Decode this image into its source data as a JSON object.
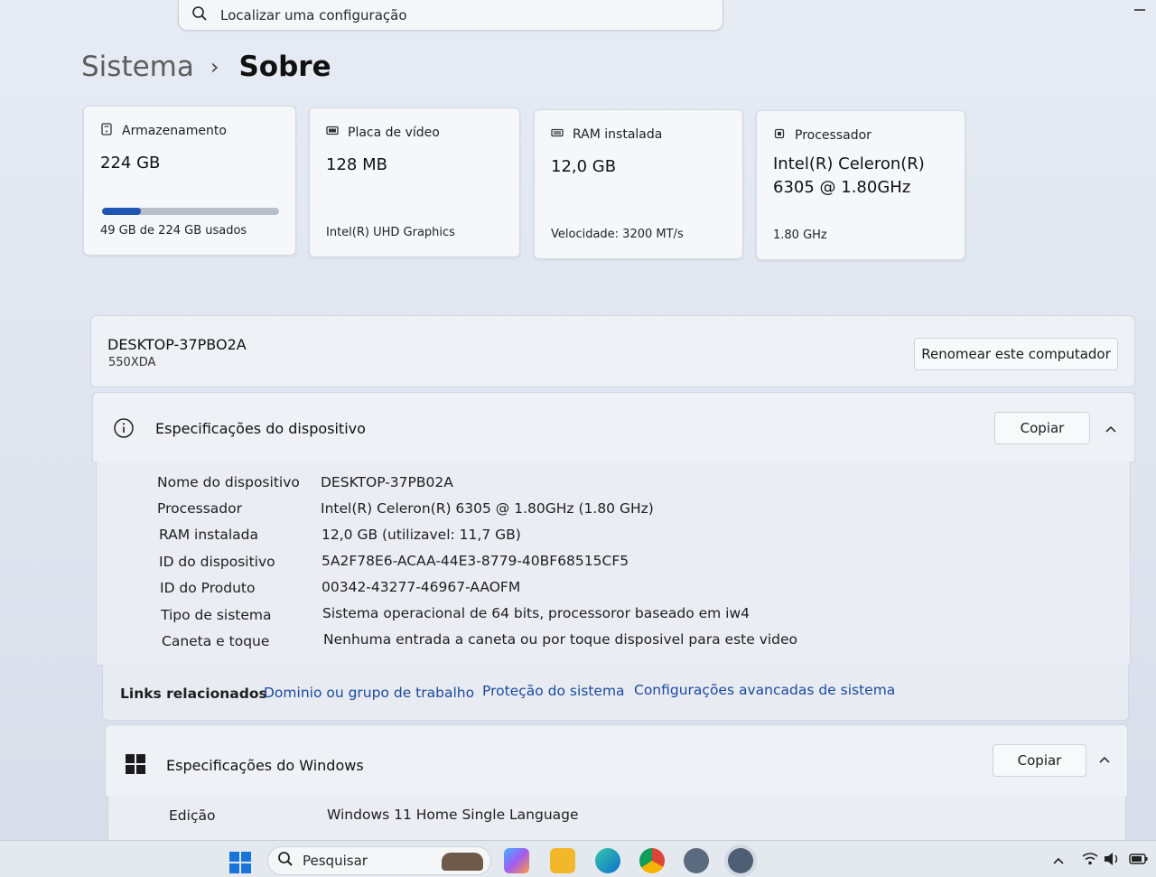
{
  "search": {
    "placeholder": "Localizar uma configuração"
  },
  "breadcrumb": {
    "parent": "Sistema",
    "separator": "›",
    "current": "Sobre"
  },
  "cards": [
    {
      "title": "Armazenamento",
      "value": "224 GB",
      "detail": "49 GB de 224 GB usados",
      "usage_fraction": 0.22
    },
    {
      "title": "Placa de vídeo",
      "value": "128 MB",
      "detail": "Intel(R) UHD Graphics"
    },
    {
      "title": "RAM instalada",
      "value": "12,0 GB",
      "detail": "Velocidade: 3200 MT/s"
    },
    {
      "title": "Processador",
      "value_line1": "Intel(R) Celeron(R)",
      "value_line2": "6305 @ 1.80GHz",
      "detail": "1.80 GHz"
    }
  ],
  "computer": {
    "name": "DESKTOP-37PBO2A",
    "model": "550XDA",
    "rename_label": "Renomear este computador"
  },
  "device_specs": {
    "title": "Especificações do dispositivo",
    "copy_label": "Copiar",
    "rows": [
      {
        "label": "Nome do dispositivo",
        "value": "DESKTOP-37PB02A"
      },
      {
        "label": "Processador",
        "value": "Intel(R) Celeron(R) 6305 @ 1.80GHz (1.80 GHz)"
      },
      {
        "label": "RAM instalada",
        "value": "12,0 GB (utilizavel: 11,7 GB)"
      },
      {
        "label": "ID do dispositivo",
        "value": "5A2F78E6-ACAA-44E3-8779-40BF68515CF5"
      },
      {
        "label": "ID do Produto",
        "value": "00342-43277-46967-AAOFM"
      },
      {
        "label": "Tipo de sistema",
        "value": "Sistema operacional de 64 bits, processoror baseado em iw4"
      },
      {
        "label": "Caneta e toque",
        "value": "Nenhuma entrada a caneta ou por toque disposivel para este video"
      }
    ]
  },
  "related_links": {
    "label": "Links relacionados",
    "links": [
      "Dominio ou grupo de trabalho",
      "Proteção do sistema",
      "Configurações avancadas de sistema"
    ]
  },
  "windows_specs": {
    "title": "Especificações do Windows",
    "copy_label": "Copiar",
    "rows": [
      {
        "label": "Edição",
        "value": "Windows 11 Home Single Language"
      }
    ]
  },
  "taskbar": {
    "search_label": "Pesquisar"
  },
  "colors": {
    "accent": "#1f55b3",
    "link": "#1a4a9e"
  }
}
